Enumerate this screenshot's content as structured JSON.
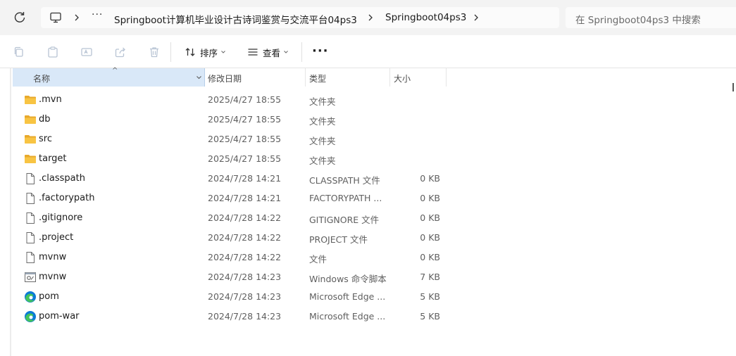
{
  "breadcrumb": {
    "more": "···",
    "items": [
      "Springboot计算机毕业设计古诗词鉴赏与交流平台04ps3",
      "Springboot04ps3"
    ]
  },
  "search": {
    "placeholder": "在 Springboot04ps3 中搜索"
  },
  "toolbar": {
    "sort_label": "排序",
    "view_label": "查看",
    "more_label": "···"
  },
  "columns": {
    "name": "名称",
    "modified": "修改日期",
    "type": "类型",
    "size": "大小"
  },
  "files": [
    {
      "name": ".mvn",
      "modified": "2025/4/27 18:55",
      "type": "文件夹",
      "size": "",
      "icon": "folder-icon"
    },
    {
      "name": "db",
      "modified": "2025/4/27 18:55",
      "type": "文件夹",
      "size": "",
      "icon": "folder-icon"
    },
    {
      "name": "src",
      "modified": "2025/4/27 18:55",
      "type": "文件夹",
      "size": "",
      "icon": "folder-icon"
    },
    {
      "name": "target",
      "modified": "2025/4/27 18:55",
      "type": "文件夹",
      "size": "",
      "icon": "folder-icon"
    },
    {
      "name": ".classpath",
      "modified": "2024/7/28 14:21",
      "type": "CLASSPATH 文件",
      "size": "0 KB",
      "icon": "file-icon"
    },
    {
      "name": ".factorypath",
      "modified": "2024/7/28 14:21",
      "type": "FACTORYPATH ...",
      "size": "0 KB",
      "icon": "file-icon"
    },
    {
      "name": ".gitignore",
      "modified": "2024/7/28 14:22",
      "type": "GITIGNORE 文件",
      "size": "0 KB",
      "icon": "file-icon"
    },
    {
      "name": ".project",
      "modified": "2024/7/28 14:22",
      "type": "PROJECT 文件",
      "size": "0 KB",
      "icon": "file-icon"
    },
    {
      "name": "mvnw",
      "modified": "2024/7/28 14:22",
      "type": "文件",
      "size": "0 KB",
      "icon": "file-icon"
    },
    {
      "name": "mvnw",
      "modified": "2024/7/28 14:23",
      "type": "Windows 命令脚本",
      "size": "7 KB",
      "icon": "script-icon"
    },
    {
      "name": "pom",
      "modified": "2024/7/28 14:23",
      "type": "Microsoft Edge ...",
      "size": "5 KB",
      "icon": "edge-icon"
    },
    {
      "name": "pom-war",
      "modified": "2024/7/28 14:23",
      "type": "Microsoft Edge ...",
      "size": "5 KB",
      "icon": "edge-icon"
    }
  ],
  "colors": {
    "accent": "#0067c0",
    "header_selected": "#d9e8f8",
    "folder": "#f8c443"
  }
}
